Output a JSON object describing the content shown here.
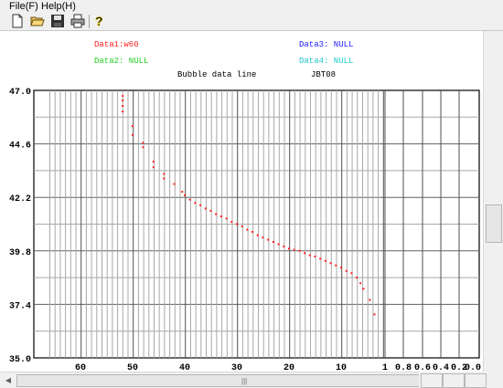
{
  "menu": {
    "file": "File(F)",
    "help": "Help(H)"
  },
  "toolbar": {
    "icons": [
      "new-file-icon",
      "open-folder-icon",
      "save-icon",
      "print-icon",
      "help-icon"
    ],
    "help_glyph": "?"
  },
  "legend": {
    "data1": "Data1:w60",
    "data1_color": "#ff2020",
    "data2": "Data2: NULL",
    "data2_color": "#20d020",
    "data3": "Data3: NULL",
    "data3_color": "#2020ff",
    "data4": "Data4: NULL",
    "data4_color": "#20c8c8"
  },
  "chart_data": {
    "type": "scatter",
    "title": "Bubble data line",
    "subtitle": "JBT08",
    "yticks": [
      "47.0",
      "44.6",
      "42.2",
      "39.8",
      "37.4",
      "35.0"
    ],
    "ylim": [
      35.0,
      47.0
    ],
    "xticks": [
      "60",
      "50",
      "40",
      "30",
      "20",
      "10",
      "1",
      "0.8",
      "0.6",
      "0.4",
      "0.2",
      "0.0"
    ],
    "grid": true,
    "series": [
      {
        "name": "Data1:w60",
        "color": "#ff2020",
        "points": [
          [
            51.9,
            46.75
          ],
          [
            51.9,
            46.55
          ],
          [
            51.9,
            46.3
          ],
          [
            51.9,
            46.05
          ],
          [
            50,
            45.4
          ],
          [
            50,
            45.0
          ],
          [
            48,
            44.65
          ],
          [
            48,
            44.45
          ],
          [
            46,
            43.8
          ],
          [
            46,
            43.55
          ],
          [
            44,
            43.25
          ],
          [
            44,
            43.05
          ],
          [
            42,
            42.8
          ],
          [
            40.5,
            42.45
          ],
          [
            40,
            42.3
          ],
          [
            39,
            42.1
          ],
          [
            38,
            41.95
          ],
          [
            37,
            41.85
          ],
          [
            36,
            41.7
          ],
          [
            35,
            41.6
          ],
          [
            34,
            41.45
          ],
          [
            33,
            41.35
          ],
          [
            32,
            41.25
          ],
          [
            31,
            41.1
          ],
          [
            30,
            41.0
          ],
          [
            29,
            40.9
          ],
          [
            28,
            40.75
          ],
          [
            27,
            40.65
          ],
          [
            26,
            40.5
          ],
          [
            25,
            40.4
          ],
          [
            24,
            40.3
          ],
          [
            23,
            40.2
          ],
          [
            22,
            40.1
          ],
          [
            21,
            40.0
          ],
          [
            20,
            39.9
          ],
          [
            19,
            39.85
          ],
          [
            18,
            39.8
          ],
          [
            17,
            39.7
          ],
          [
            16,
            39.6
          ],
          [
            15,
            39.55
          ],
          [
            14,
            39.45
          ],
          [
            13,
            39.35
          ],
          [
            12,
            39.25
          ],
          [
            11,
            39.15
          ],
          [
            10,
            39.05
          ],
          [
            9,
            38.9
          ],
          [
            8,
            38.8
          ],
          [
            7,
            38.6
          ],
          [
            6.3,
            38.35
          ],
          [
            5.7,
            38.1
          ],
          [
            4.5,
            37.6
          ],
          [
            3.6,
            36.95
          ]
        ]
      }
    ]
  }
}
